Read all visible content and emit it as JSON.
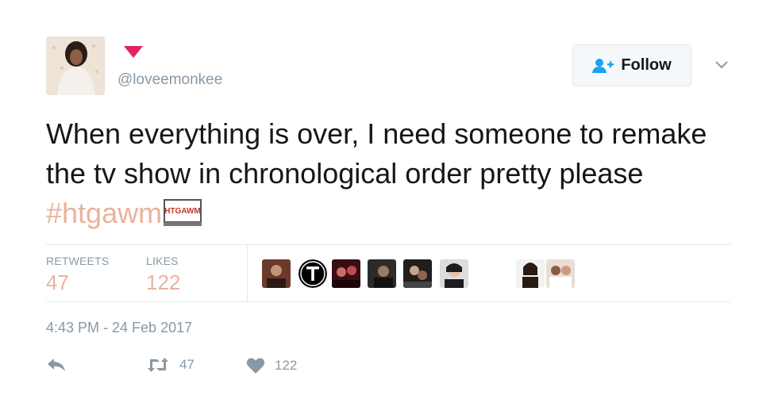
{
  "user": {
    "handle": "@loveemonkee"
  },
  "follow": {
    "label": "Follow"
  },
  "tweet": {
    "text_main": "When everything is over, I need someone to remake the tv show in chronological order pretty please ",
    "hashtag": "#htgawm",
    "emoji_text": "HTGAWM"
  },
  "stats": {
    "retweets_label": "RETWEETS",
    "retweets_value": "47",
    "likes_label": "LIKES",
    "likes_value": "122"
  },
  "liker_avatars": [
    "avatar-1",
    "avatar-t",
    "avatar-3",
    "avatar-4",
    "avatar-5",
    "avatar-6",
    "avatar-7",
    "avatar-8"
  ],
  "timestamp": "4:43 PM - 24 Feb 2017",
  "actions": {
    "retweet_count": "47",
    "like_count": "122"
  },
  "colors": {
    "accent_count": "#e9b39c",
    "muted": "#8899a6",
    "follow_icon": "#1da1f2",
    "mark": "#e0245e"
  }
}
